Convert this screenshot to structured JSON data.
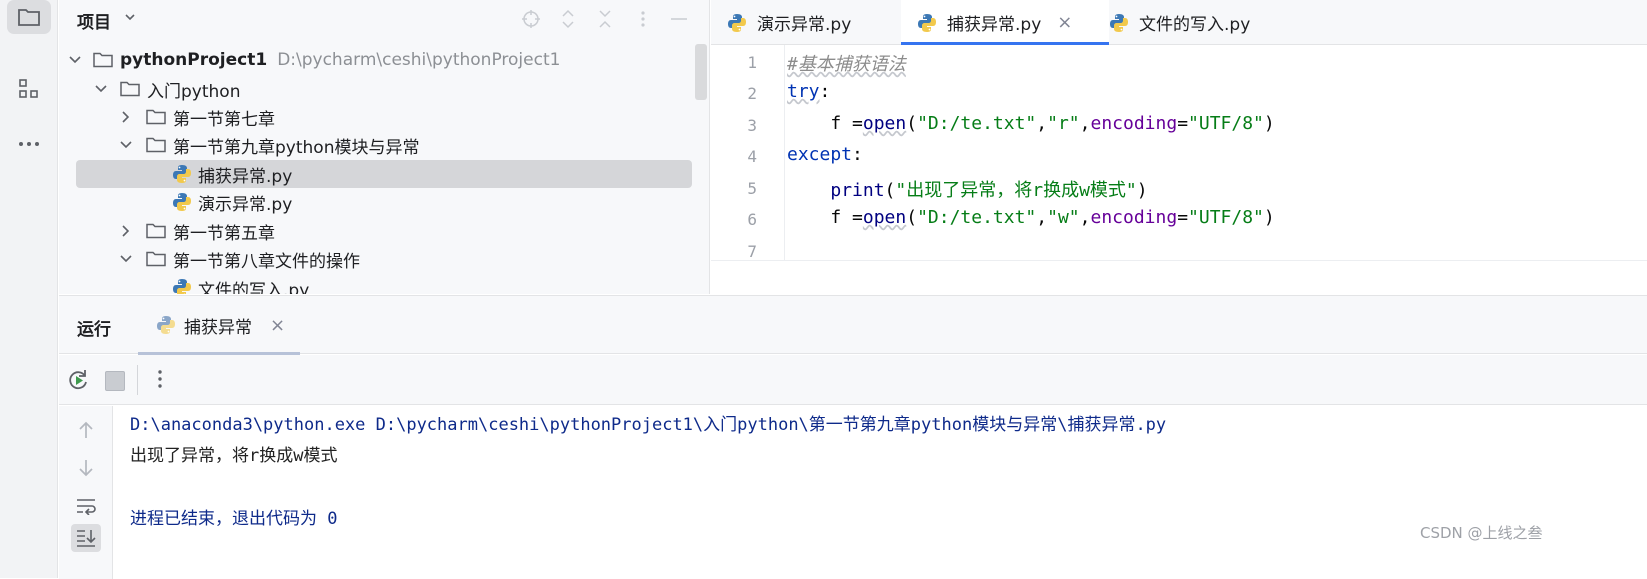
{
  "project_panel": {
    "title": "项目",
    "tree": [
      {
        "label": "pythonProject1",
        "path": "D:\\pycharm\\ceshi\\pythonProject1",
        "type": "folder",
        "expanded": true
      },
      {
        "label": "入门python",
        "type": "folder",
        "expanded": true
      },
      {
        "label": "第一节第七章",
        "type": "folder",
        "expanded": false
      },
      {
        "label": "第一节第九章python模块与异常",
        "type": "folder",
        "expanded": true
      },
      {
        "label": "捕获异常.py",
        "type": "python-file",
        "selected": true
      },
      {
        "label": "演示异常.py",
        "type": "python-file"
      },
      {
        "label": "第一节第五章",
        "type": "folder",
        "expanded": false
      },
      {
        "label": "第一节第八章文件的操作",
        "type": "folder",
        "expanded": true
      },
      {
        "label": "文件的写入.py",
        "type": "python-file"
      }
    ]
  },
  "editor": {
    "tabs": [
      {
        "label": "演示异常.py",
        "active": false
      },
      {
        "label": "捕获异常.py",
        "active": true,
        "close": "×"
      },
      {
        "label": "文件的写入.py",
        "active": false
      }
    ],
    "line_numbers": [
      "1",
      "2",
      "3",
      "4",
      "5",
      "6",
      "7"
    ],
    "code": {
      "l1": "#基本捕获语法",
      "l2_kw": "try",
      "l2_colon": ":",
      "l3_var": "    f =",
      "l3_fn": "open",
      "l3_p1": "(",
      "l3_s1": "\"D:/te.txt\"",
      "l3_c1": ",",
      "l3_s2": "\"r\"",
      "l3_c2": ",",
      "l3_param": "encoding",
      "l3_eq": "=",
      "l3_s3": "\"UTF/8\"",
      "l3_p2": ")",
      "l4_kw": "except",
      "l4_colon": ":",
      "l5_indent": "    ",
      "l5_fn": "print",
      "l5_p1": "(",
      "l5_s": "\"出现了异常，将r换成w模式\"",
      "l5_p2": ")",
      "l6_var": "    f =",
      "l6_fn": "open",
      "l6_p1": "(",
      "l6_s1": "\"D:/te.txt\"",
      "l6_c1": ",",
      "l6_s2": "\"w\"",
      "l6_c2": ",",
      "l6_param": "encoding",
      "l6_eq": "=",
      "l6_s3": "\"UTF/8\"",
      "l6_p2": ")"
    }
  },
  "run_panel": {
    "title": "运行",
    "tab_label": "捕获异常",
    "tab_close": "×",
    "console": [
      "D:\\anaconda3\\python.exe D:\\pycharm\\ceshi\\pythonProject1\\入门python\\第一节第九章python模块与异常\\捕获异常.py",
      "出现了异常，将r换成w模式",
      "",
      "进程已结束，退出代码为 0"
    ]
  },
  "watermark": "CSDN @上线之叁",
  "colors": {
    "accent": "#3574f0",
    "keyword": "#0033b3",
    "string": "#067d17",
    "param": "#660099",
    "comment": "#8c8c8c"
  }
}
